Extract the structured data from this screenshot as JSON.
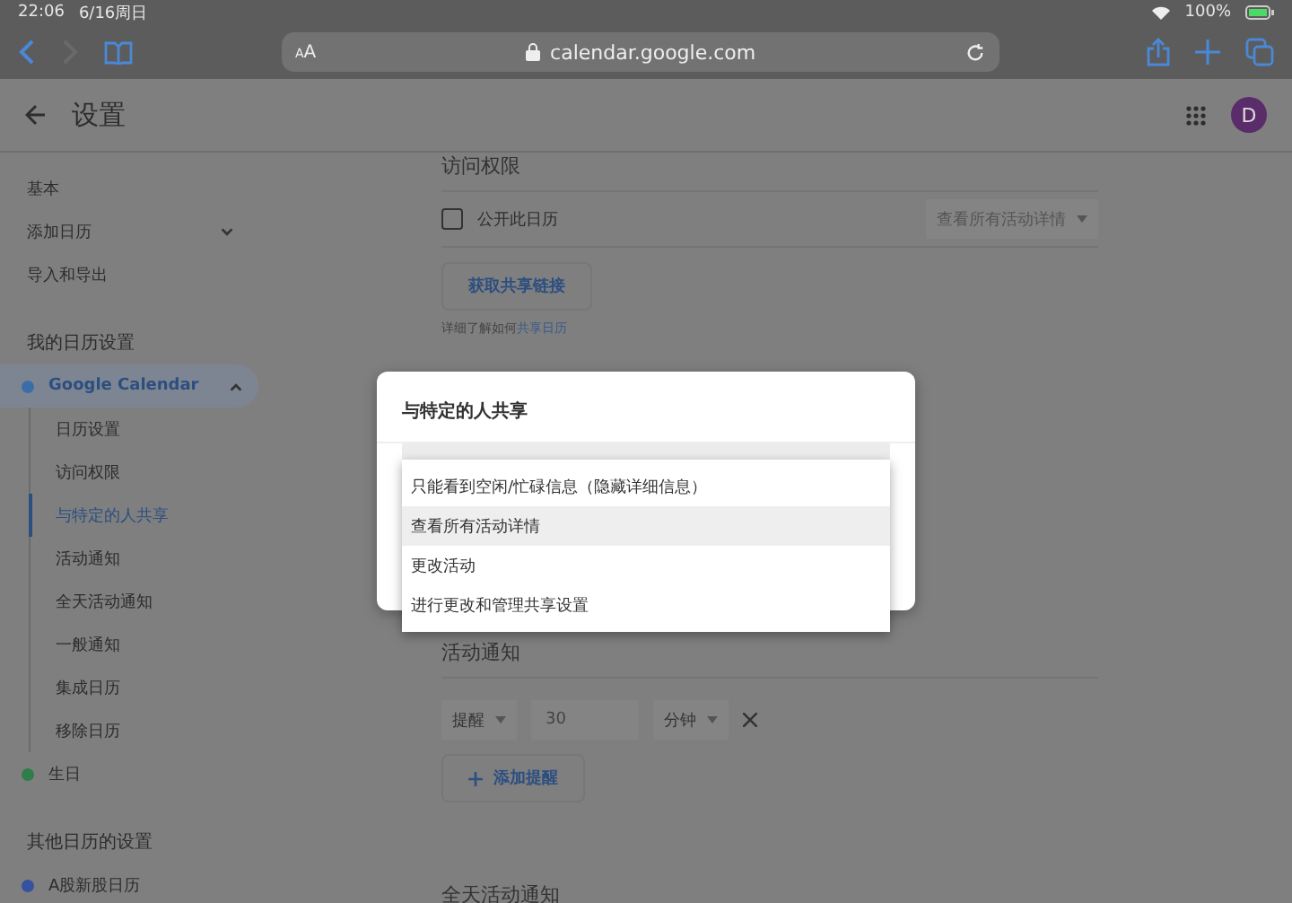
{
  "status_bar": {
    "time": "22:06",
    "date": "6/16周日",
    "battery": "100%"
  },
  "browser": {
    "text_size": "AA",
    "url": "calendar.google.com"
  },
  "header": {
    "title": "设置",
    "avatar": "D"
  },
  "sidebar": {
    "items": [
      {
        "kind": "item",
        "label": "基本"
      },
      {
        "kind": "item",
        "label": "添加日历",
        "expanded": false
      },
      {
        "kind": "item",
        "label": "导入和导出"
      },
      {
        "kind": "heading",
        "label": "我的日历设置"
      },
      {
        "kind": "calendar",
        "label": "Google Calendar",
        "color": "#3b6ea8",
        "expanded": true,
        "children": [
          {
            "label": "日历设置",
            "selected": false
          },
          {
            "label": "访问权限",
            "selected": false
          },
          {
            "label": "与特定的人共享",
            "selected": true
          },
          {
            "label": "活动通知",
            "selected": false
          },
          {
            "label": "全天活动通知",
            "selected": false
          },
          {
            "label": "一般通知",
            "selected": false
          },
          {
            "label": "集成日历",
            "selected": false
          },
          {
            "label": "移除日历",
            "selected": false
          }
        ]
      },
      {
        "kind": "calendar",
        "label": "生日",
        "color": "#2e7d4a"
      },
      {
        "kind": "heading",
        "label": "其他日历的设置"
      },
      {
        "kind": "calendar",
        "label": "A股新股日历",
        "color": "#3552a0"
      }
    ]
  },
  "access": {
    "title": "访问权限",
    "public_checkbox": {
      "label": "公开此日历",
      "checked": false
    },
    "permission_select": "查看所有活动详情",
    "share_link_button": "获取共享链接",
    "help": "详细了解如何",
    "help_link": "共享日历"
  },
  "notifications": {
    "title": "活动通知",
    "reminder": {
      "type": "提醒",
      "value": "30",
      "unit": "分钟"
    },
    "add_button": "添加提醒"
  },
  "all_day": {
    "title": "全天活动通知"
  },
  "dialog": {
    "title": "与特定的人共享",
    "options": [
      {
        "label": "只能看到空闲/忙碌信息（隐藏详细信息）",
        "selected": false
      },
      {
        "label": "查看所有活动详情",
        "selected": true
      },
      {
        "label": "更改活动",
        "selected": false
      },
      {
        "label": "进行更改和管理共享设置",
        "selected": false
      }
    ]
  }
}
